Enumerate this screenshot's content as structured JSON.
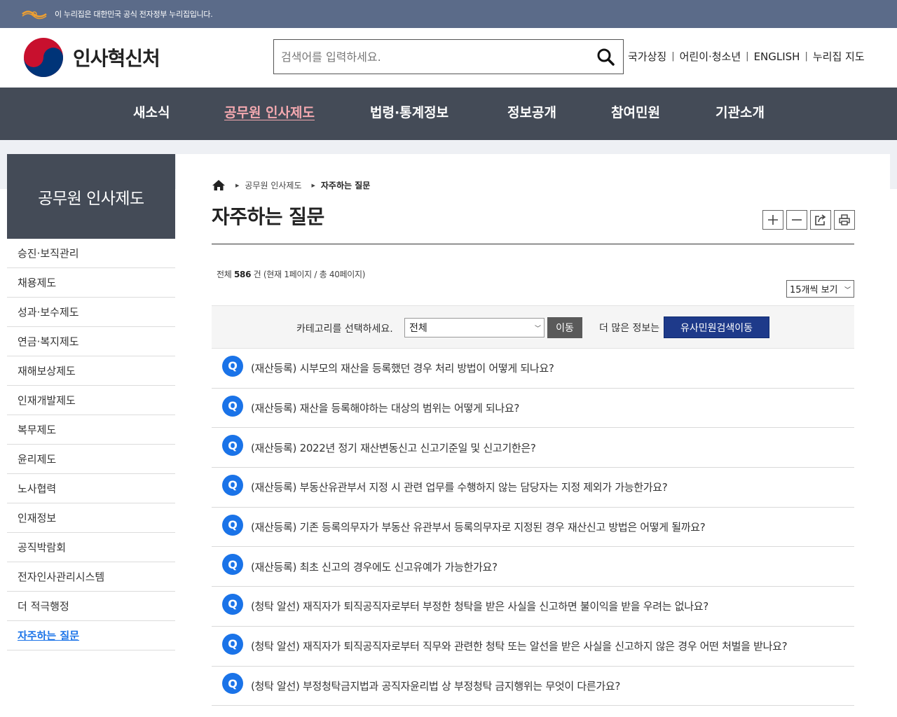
{
  "gov_banner": {
    "text": "이 누리집은 대한민국 공식 전자정부 누리집입니다."
  },
  "header": {
    "logo_text": "인사혁신처",
    "search_placeholder": "검색어를 입력하세요.",
    "utility_links": [
      "국가상징",
      "어린이·청소년",
      "ENGLISH",
      "누리집 지도"
    ]
  },
  "gnb": {
    "items": [
      {
        "label": "새소식",
        "active": false
      },
      {
        "label": "공무원 인사제도",
        "active": true
      },
      {
        "label": "법령·통계정보",
        "active": false
      },
      {
        "label": "정보공개",
        "active": false
      },
      {
        "label": "참여민원",
        "active": false
      },
      {
        "label": "기관소개",
        "active": false
      }
    ]
  },
  "sidebar": {
    "title": "공무원 인사제도",
    "items": [
      {
        "label": "승진·보직관리"
      },
      {
        "label": "채용제도"
      },
      {
        "label": "성과·보수제도"
      },
      {
        "label": "연금·복지제도"
      },
      {
        "label": "재해보상제도"
      },
      {
        "label": "인재개발제도"
      },
      {
        "label": "복무제도"
      },
      {
        "label": "윤리제도"
      },
      {
        "label": "노사협력"
      },
      {
        "label": "인재정보"
      },
      {
        "label": "공직박람회"
      },
      {
        "label": "전자인사관리시스템"
      },
      {
        "label": "더 적극행정"
      },
      {
        "label": "자주하는 질문",
        "active": true
      }
    ]
  },
  "breadcrumb": {
    "level1": "공무원 인사제도",
    "current": "자주하는 질문"
  },
  "page": {
    "title": "자주하는 질문",
    "count_prefix": "전체 ",
    "count_total": "586",
    "count_suffix": " 건 (현재 1페이지 / 총 40페이지)",
    "per_page": "15개씩 보기"
  },
  "filter": {
    "label": "카테고리를 선택하세요.",
    "selected": "전체",
    "go_button": "이동",
    "more_label": "더 많은 정보는",
    "more_button": "유사민원검색이동"
  },
  "faq": {
    "badge": "Q",
    "items": [
      "(재산등록) 시부모의 재산을 등록했던 경우 처리 방법이 어떻게 되나요?",
      "(재산등록) 재산을 등록해야하는 대상의 범위는 어떻게 되나요?",
      "(재산등록) 2022년 정기 재산변동신고 신고기준일 및 신고기한은?",
      "(재산등록) 부동산유관부서 지정 시 관련 업무를 수행하지 않는 담당자는 지정 제외가 가능한가요?",
      "(재산등록) 기존 등록의무자가 부동산 유관부서 등록의무자로 지정된 경우 재산신고 방법은 어떻게 될까요?",
      "(재산등록) 최초 신고의 경우에도 신고유예가 가능한가요?",
      "(청탁 알선) 재직자가 퇴직공직자로부터 부정한 청탁을 받은 사실을 신고하면 불이익을 받을 우려는 없나요?",
      "(청탁 알선) 재직자가 퇴직공직자로부터 직무와 관련한 청탁 또는 알선을 받은 사실을 신고하지 않은 경우 어떤 처벌을 받나요?",
      "(청탁 알선) 부정청탁금지법과 공직자윤리법 상 부정청탁 금지행위는 무엇이 다른가요?"
    ]
  },
  "colors": {
    "gnb_bg": "#444b57",
    "accent": "#1a73e8",
    "more_button": "#1e3a8a",
    "gov_bar": "#5b6b89"
  }
}
